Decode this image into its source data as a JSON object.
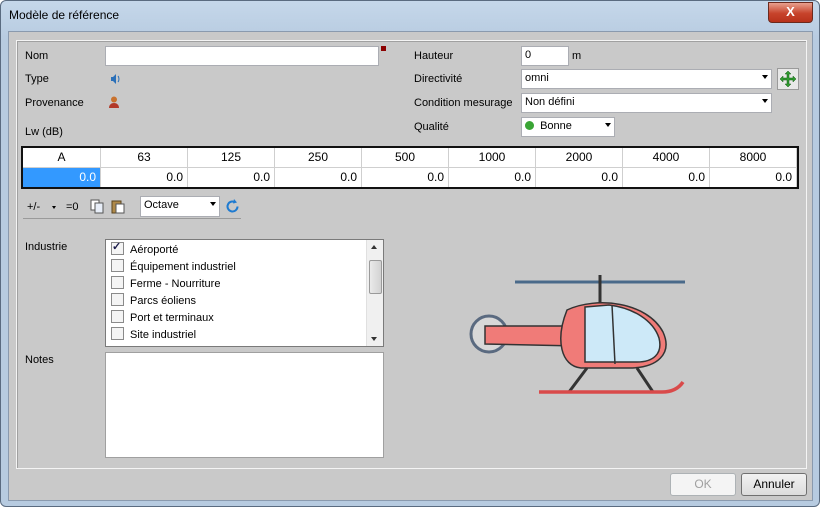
{
  "window": {
    "title": "Modèle de référence",
    "close_glyph": "X"
  },
  "form": {
    "nom_label": "Nom",
    "nom_value": "",
    "type_label": "Type",
    "type_icon": "speaker-icon",
    "provenance_label": "Provenance",
    "provenance_icon": "user-icon",
    "lw_label": "Lw (dB)",
    "hauteur_label": "Hauteur",
    "hauteur_value": "0",
    "hauteur_unit": "m",
    "directivite_label": "Directivité",
    "directivite_value": "omni",
    "condition_label": "Condition mesurage",
    "condition_value": "Non défini",
    "qualite_label": "Qualité",
    "qualite_value": "Bonne",
    "qualite_color": "#3aa535"
  },
  "frequency_table": {
    "headers": [
      "A",
      "63",
      "125",
      "250",
      "500",
      "1000",
      "2000",
      "4000",
      "8000"
    ],
    "values": [
      "0.0",
      "0.0",
      "0.0",
      "0.0",
      "0.0",
      "0.0",
      "0.0",
      "0.0",
      "0.0"
    ]
  },
  "toolbar": {
    "plusminus_label": "+/-",
    "zero_label": "=0",
    "band_value": "Octave"
  },
  "industrie": {
    "label": "Industrie",
    "items": [
      {
        "label": "Aéroporté",
        "checked": true
      },
      {
        "label": "Équipement industriel",
        "checked": false
      },
      {
        "label": "Ferme - Nourriture",
        "checked": false
      },
      {
        "label": "Parcs éoliens",
        "checked": false
      },
      {
        "label": "Port et terminaux",
        "checked": false
      },
      {
        "label": "Site industriel",
        "checked": false
      }
    ]
  },
  "notes": {
    "label": "Notes",
    "value": ""
  },
  "buttons": {
    "ok_label": "OK",
    "cancel_label": "Annuler"
  },
  "preview": {
    "icon": "helicopter-icon"
  }
}
